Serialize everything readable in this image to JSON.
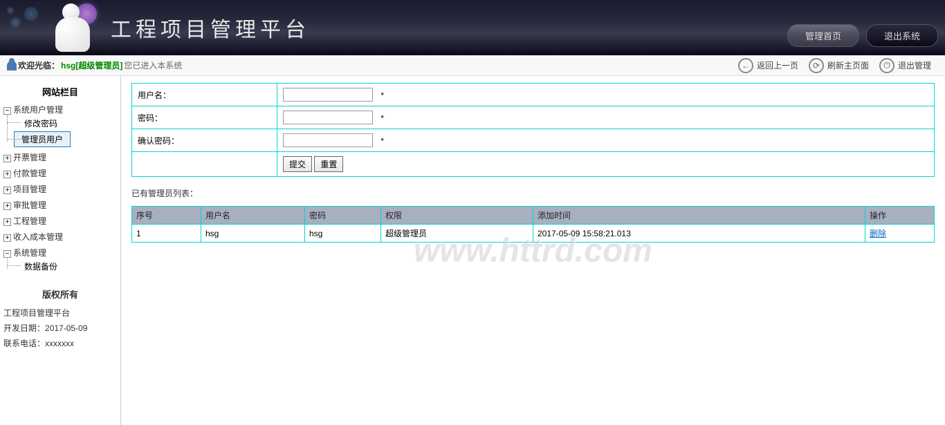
{
  "header": {
    "title": "工程项目管理平台",
    "home_btn": "管理首页",
    "exit_btn": "退出系统"
  },
  "infobar": {
    "welcome_label": "欢迎光临：",
    "user_role": "hsg[超级管理员]",
    "entered_text": " 您已进入本系统",
    "back_label": "返回上一页",
    "refresh_label": "刷新主页面",
    "logout_label": "退出管理"
  },
  "sidebar": {
    "heading": "网站栏目",
    "items": [
      {
        "label": "系统用户管理",
        "expanded": true,
        "children": [
          {
            "label": "修改密码",
            "active": false
          },
          {
            "label": "管理员用户",
            "active": true
          }
        ]
      },
      {
        "label": "开票管理",
        "expanded": false
      },
      {
        "label": "付款管理",
        "expanded": false
      },
      {
        "label": "项目管理",
        "expanded": false
      },
      {
        "label": "审批管理",
        "expanded": false
      },
      {
        "label": "工程管理",
        "expanded": false
      },
      {
        "label": "收入成本管理",
        "expanded": false
      },
      {
        "label": "系统管理",
        "expanded": true,
        "children": [
          {
            "label": "数据备份",
            "active": false
          }
        ]
      }
    ],
    "copyright_heading": "版权所有",
    "copyright_name": "工程项目管理平台",
    "dev_date_label": "开发日期：",
    "dev_date_value": "2017-05-09",
    "contact_label": "联系电话：",
    "contact_value": "xxxxxxx"
  },
  "form": {
    "username_label": "用户名：",
    "password_label": "密码：",
    "confirm_label": "确认密码：",
    "required_mark": "*",
    "submit_btn": "提交",
    "reset_btn": "重置"
  },
  "list": {
    "title": "已有管理员列表：",
    "headers": [
      "序号",
      "用户名",
      "密码",
      "权限",
      "添加时间",
      "操作"
    ],
    "rows": [
      {
        "seq": "1",
        "username": "hsg",
        "password": "hsg",
        "role": "超级管理员",
        "time": "2017-05-09 15:58:21.013",
        "action": "删除"
      }
    ]
  },
  "watermark": "www.httrd.com"
}
